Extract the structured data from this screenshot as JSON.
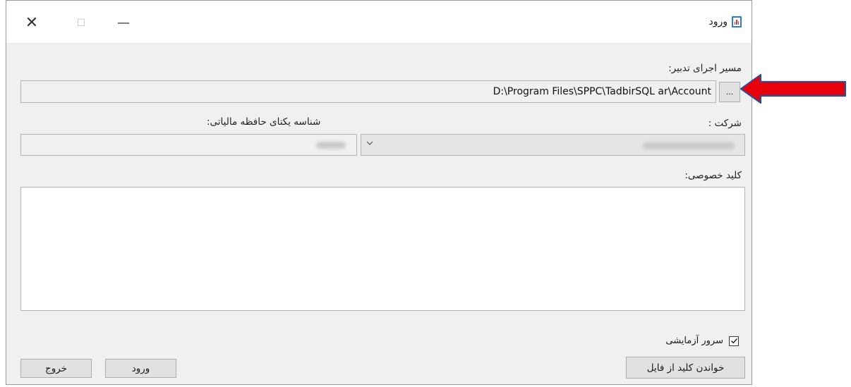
{
  "window": {
    "title": "ورود",
    "controls": {
      "close": "✕",
      "maximize": "☐",
      "minimize": "—"
    }
  },
  "path": {
    "label": "مسیر اجرای تدبیر:",
    "value": "D:\\Program Files\\SPPC\\TadbirSQL ar\\Account",
    "browse_label": "..."
  },
  "company": {
    "label": "شرکت :"
  },
  "tax_memory": {
    "label": "شناسه یکتای حافظه مالیاتی:"
  },
  "private_key": {
    "label": "کلید خصوصی:",
    "value": ""
  },
  "test_server": {
    "label": "سرور آزمایشی",
    "checked": true
  },
  "buttons": {
    "read_key_from_file": "خواندن کلید از فایل",
    "login": "ورود",
    "exit": "خروج"
  },
  "annotation": {
    "arrow_color": "#e8000b",
    "arrow_outline": "#2f4f8f"
  }
}
